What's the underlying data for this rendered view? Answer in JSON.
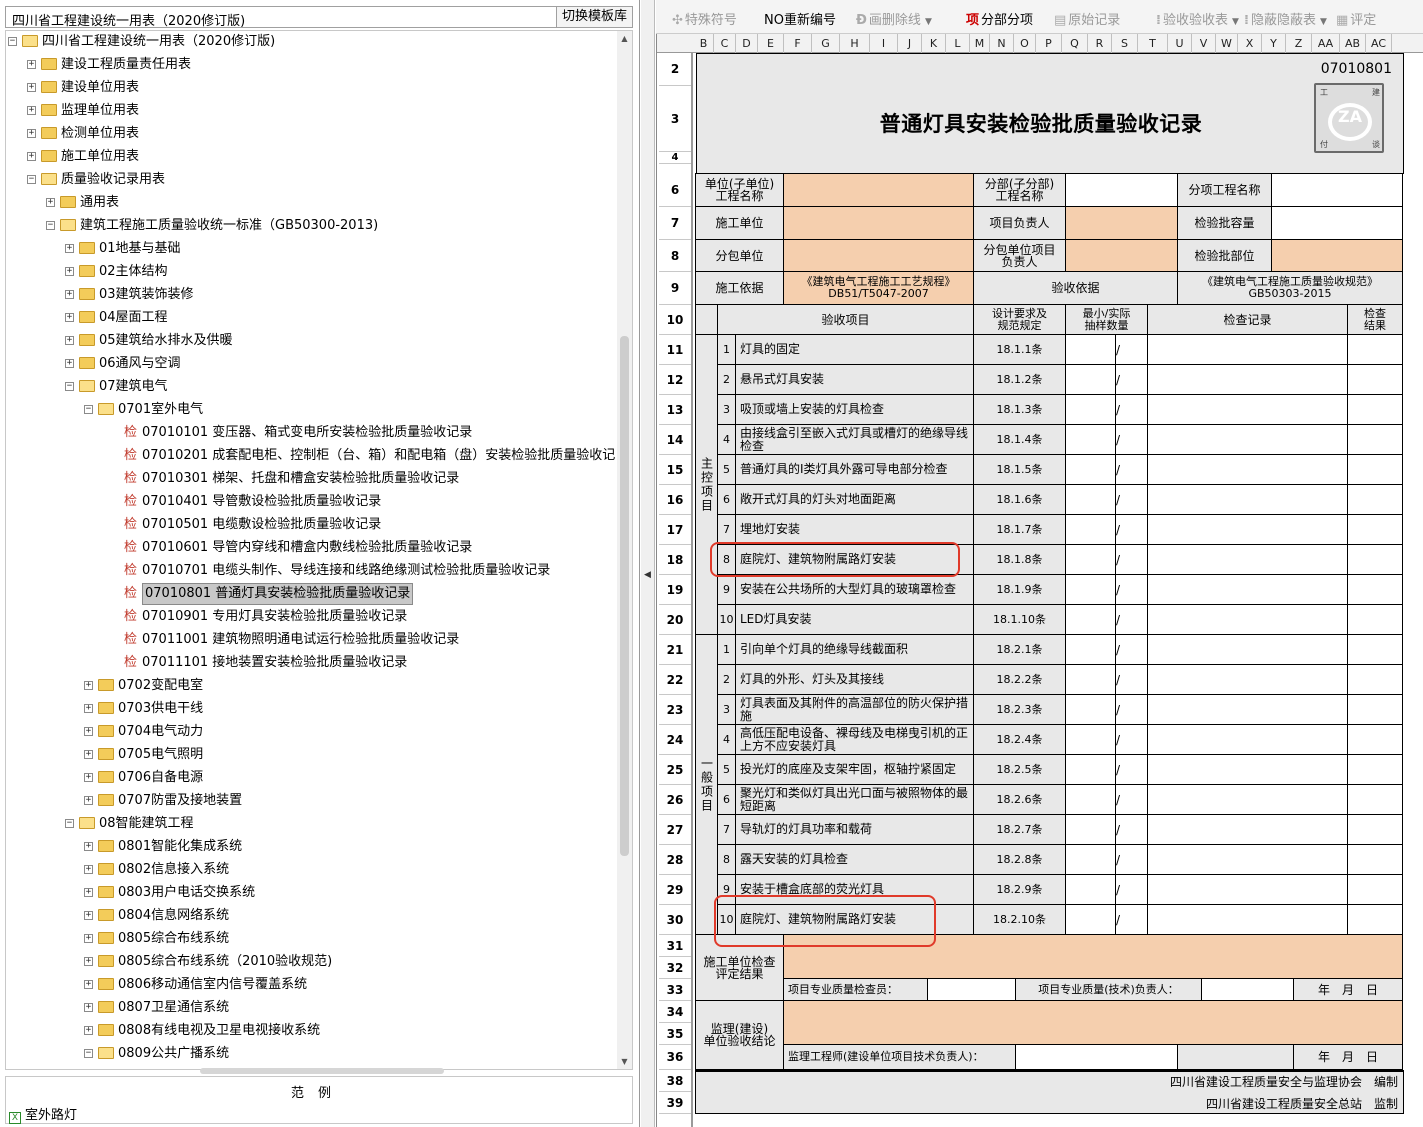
{
  "left": {
    "title": "四川省工程建设统一用表（2020修订版)",
    "switch_button": "切换模板库"
  },
  "tree": [
    {
      "label": "四川省工程建设统一用表（2020修订版)",
      "level": 0,
      "expanded": true,
      "type": "folder"
    },
    {
      "label": "建设工程质量责任用表",
      "level": 1,
      "expanded": false,
      "type": "folder"
    },
    {
      "label": "建设单位用表",
      "level": 1,
      "expanded": false,
      "type": "folder"
    },
    {
      "label": "监理单位用表",
      "level": 1,
      "expanded": false,
      "type": "folder"
    },
    {
      "label": "检测单位用表",
      "level": 1,
      "expanded": false,
      "type": "folder"
    },
    {
      "label": "施工单位用表",
      "level": 1,
      "expanded": false,
      "type": "folder"
    },
    {
      "label": "质量验收记录用表",
      "level": 1,
      "expanded": true,
      "type": "folder"
    },
    {
      "label": "通用表",
      "level": 2,
      "expanded": false,
      "type": "folder"
    },
    {
      "label": "建筑工程施工质量验收统一标准（GB50300-2013)",
      "level": 2,
      "expanded": true,
      "type": "folder"
    },
    {
      "label": "01地基与基础",
      "level": 3,
      "expanded": false,
      "type": "folder"
    },
    {
      "label": "02主体结构",
      "level": 3,
      "expanded": false,
      "type": "folder"
    },
    {
      "label": "03建筑装饰装修",
      "level": 3,
      "expanded": false,
      "type": "folder"
    },
    {
      "label": "04屋面工程",
      "level": 3,
      "expanded": false,
      "type": "folder"
    },
    {
      "label": "05建筑给水排水及供暖",
      "level": 3,
      "expanded": false,
      "type": "folder"
    },
    {
      "label": "06通风与空调",
      "level": 3,
      "expanded": false,
      "type": "folder"
    },
    {
      "label": "07建筑电气",
      "level": 3,
      "expanded": true,
      "type": "folder"
    },
    {
      "label": "0701室外电气",
      "level": 4,
      "expanded": true,
      "type": "folder"
    },
    {
      "label": "07010101 变压器、箱式变电所安装检验批质量验收记录",
      "level": 5,
      "type": "doc"
    },
    {
      "label": "07010201 成套配电柜、控制柜（台、箱）和配电箱（盘）安装检验批质量验收记",
      "level": 5,
      "type": "doc"
    },
    {
      "label": "07010301 梯架、托盘和槽盒安装检验批质量验收记录",
      "level": 5,
      "type": "doc"
    },
    {
      "label": "07010401 导管敷设检验批质量验收记录",
      "level": 5,
      "type": "doc"
    },
    {
      "label": "07010501 电缆敷设检验批质量验收记录",
      "level": 5,
      "type": "doc"
    },
    {
      "label": "07010601 导管内穿线和槽盒内敷线检验批质量验收记录",
      "level": 5,
      "type": "doc"
    },
    {
      "label": "07010701 电缆头制作、导线连接和线路绝缘测试检验批质量验收记录",
      "level": 5,
      "type": "doc"
    },
    {
      "label": "07010801 普通灯具安装检验批质量验收记录",
      "level": 5,
      "type": "doc",
      "selected": true
    },
    {
      "label": "07010901 专用灯具安装检验批质量验收记录",
      "level": 5,
      "type": "doc"
    },
    {
      "label": "07011001 建筑物照明通电试运行检验批质量验收记录",
      "level": 5,
      "type": "doc"
    },
    {
      "label": "07011101 接地装置安装检验批质量验收记录",
      "level": 5,
      "type": "doc"
    },
    {
      "label": "0702变配电室",
      "level": 4,
      "expanded": false,
      "type": "folder"
    },
    {
      "label": "0703供电干线",
      "level": 4,
      "expanded": false,
      "type": "folder"
    },
    {
      "label": "0704电气动力",
      "level": 4,
      "expanded": false,
      "type": "folder"
    },
    {
      "label": "0705电气照明",
      "level": 4,
      "expanded": false,
      "type": "folder"
    },
    {
      "label": "0706自备电源",
      "level": 4,
      "expanded": false,
      "type": "folder"
    },
    {
      "label": "0707防雷及接地装置",
      "level": 4,
      "expanded": false,
      "type": "folder"
    },
    {
      "label": "08智能建筑工程",
      "level": 3,
      "expanded": true,
      "type": "folder"
    },
    {
      "label": "0801智能化集成系统",
      "level": 4,
      "expanded": false,
      "type": "folder"
    },
    {
      "label": "0802信息接入系统",
      "level": 4,
      "expanded": false,
      "type": "folder"
    },
    {
      "label": "0803用户电话交换系统",
      "level": 4,
      "expanded": false,
      "type": "folder"
    },
    {
      "label": "0804信息网络系统",
      "level": 4,
      "expanded": false,
      "type": "folder"
    },
    {
      "label": "0805综合布线系统",
      "level": 4,
      "expanded": false,
      "type": "folder"
    },
    {
      "label": "0805综合布线系统（2010验收规范)",
      "level": 4,
      "expanded": false,
      "type": "folder"
    },
    {
      "label": "0806移动通信室内信号覆盖系统",
      "level": 4,
      "expanded": false,
      "type": "folder"
    },
    {
      "label": "0807卫星通信系统",
      "level": 4,
      "expanded": false,
      "type": "folder"
    },
    {
      "label": "0808有线电视及卫星电视接收系统",
      "level": 4,
      "expanded": false,
      "type": "folder"
    },
    {
      "label": "0809公共广播系统",
      "level": 4,
      "expanded": true,
      "type": "folder"
    }
  ],
  "doc_marker": "检",
  "legend": {
    "title": "范例",
    "item": "室外路灯",
    "item_icon": "excel-icon"
  },
  "toolbar": [
    {
      "label": "特殊符号",
      "icon": "✣",
      "enabled": false
    },
    {
      "label": "NO重新编号",
      "icon": "",
      "enabled": true
    },
    {
      "label": "删除线",
      "icon": "Ð",
      "enabled": false
    },
    {
      "label": "分部分项",
      "icon": "项",
      "enabled": true
    },
    {
      "label": "原始记录",
      "icon": "▤",
      "enabled": false
    },
    {
      "label": "验收",
      "icon": "⁞",
      "enabled": false
    },
    {
      "label": "隐蔽",
      "icon": "⁞",
      "enabled": false
    },
    {
      "label": "评定",
      "icon": "▦",
      "enabled": false
    }
  ],
  "toolbar_extra": {
    "strike_prefix": "画",
    "verify_suffix": "验收表",
    "hidden_suffix": "隐蔽表"
  },
  "columns": [
    "B",
    "C",
    "D",
    "E",
    "F",
    "G",
    "H",
    "I",
    "J",
    "K",
    "L",
    "M",
    "N",
    "O",
    "P",
    "Q",
    "R",
    "S",
    "T",
    "U",
    "V",
    "W",
    "X",
    "Y",
    "Z",
    "AA",
    "AB",
    "AC"
  ],
  "rows": [
    "2",
    "3",
    "4",
    "6",
    "7",
    "8",
    "9",
    "10",
    "11",
    "12",
    "13",
    "14",
    "15",
    "16",
    "17",
    "18",
    "19",
    "20",
    "21",
    "22",
    "23",
    "24",
    "25",
    "26",
    "27",
    "28",
    "29",
    "30",
    "31",
    "32",
    "33",
    "34",
    "35",
    "36",
    "38",
    "39"
  ],
  "form": {
    "code": "07010801",
    "logo_text": "ZA",
    "logo_corners": [
      "工",
      "建",
      "付",
      "谈"
    ],
    "title": "普通灯具安装检验批质量验收记录",
    "h_unit": "单位(子单位)\n工程名称",
    "h_sub": "分部(子分部)\n工程名称",
    "h_item": "分项工程名称",
    "h_contractor": "施工单位",
    "h_pm": "项目负责人",
    "h_capacity": "检验批容量",
    "h_subcontractor": "分包单位",
    "h_sub_pm": "分包单位项目\n负责人",
    "h_part": "检验批部位",
    "h_basis": "施工依据",
    "basis_value": "《建筑电气工程施工工艺规程》\nDB51/T5047-2007",
    "h_accept_basis": "验收依据",
    "accept_basis_value": "《建筑电气工程施工质量验收规范》\nGB50303-2015",
    "col_item": "验收项目",
    "col_req": "设计要求及\n规范规定",
    "col_sample": "最小/实际\n抽样数量",
    "col_record": "检查记录",
    "col_result": "检查\n结果",
    "main_label": "主控项目",
    "general_label": "一般项目",
    "slash": "/",
    "main_items": [
      {
        "n": "1",
        "text": "灯具的固定",
        "req": "18.1.1条"
      },
      {
        "n": "2",
        "text": "悬吊式灯具安装",
        "req": "18.1.2条"
      },
      {
        "n": "3",
        "text": "吸顶或墙上安装的灯具检查",
        "req": "18.1.3条"
      },
      {
        "n": "4",
        "text": "由接线盒引至嵌入式灯具或槽灯的绝缘导线检查",
        "req": "18.1.4条"
      },
      {
        "n": "5",
        "text": "普通灯具的Ⅰ类灯具外露可导电部分检查",
        "req": "18.1.5条"
      },
      {
        "n": "6",
        "text": "敞开式灯具的灯头对地面距离",
        "req": "18.1.6条"
      },
      {
        "n": "7",
        "text": "埋地灯安装",
        "req": "18.1.7条"
      },
      {
        "n": "8",
        "text": "庭院灯、建筑物附属路灯安装",
        "req": "18.1.8条"
      },
      {
        "n": "9",
        "text": "安装在公共场所的大型灯具的玻璃罩检查",
        "req": "18.1.9条"
      },
      {
        "n": "10",
        "text": "LED灯具安装",
        "req": "18.1.10条"
      }
    ],
    "general_items": [
      {
        "n": "1",
        "text": "引向单个灯具的绝缘导线截面积",
        "req": "18.2.1条"
      },
      {
        "n": "2",
        "text": "灯具的外形、灯头及其接线",
        "req": "18.2.2条"
      },
      {
        "n": "3",
        "text": "灯具表面及其附件的高温部位的防火保护措施",
        "req": "18.2.3条"
      },
      {
        "n": "4",
        "text": "高低压配电设备、裸母线及电梯曳引机的正上方不应安装灯具",
        "req": "18.2.4条"
      },
      {
        "n": "5",
        "text": "投光灯的底座及支架牢固，枢轴拧紧固定",
        "req": "18.2.5条"
      },
      {
        "n": "6",
        "text": "聚光灯和类似灯具出光口面与被照物体的最短距离",
        "req": "18.2.6条"
      },
      {
        "n": "7",
        "text": "导轨灯的灯具功率和载荷",
        "req": "18.2.7条"
      },
      {
        "n": "8",
        "text": "露天安装的灯具检查",
        "req": "18.2.8条"
      },
      {
        "n": "9",
        "text": "安装于槽盒底部的荧光灯具",
        "req": "18.2.9条"
      },
      {
        "n": "10",
        "text": "庭院灯、建筑物附属路灯安装",
        "req": "18.2.10条"
      }
    ],
    "contractor_check": "施工单位检查\n评定结果",
    "inspector": "项目专业质量检查员：",
    "tech_lead": "项目专业质量(技术)负责人：",
    "date": "年　月　日",
    "supervisor_conclusion": "监理(建设)\n单位验收结论",
    "supervisor_engineer": "监理工程师(建设单位项目技术负责人)：",
    "footer1": "四川省建设工程质量安全与监理协会　编制",
    "footer2": "四川省建设工程质量安全总站　监制"
  },
  "colors": {
    "highlight": "#e03a2a",
    "input_fill": "#f5cfae",
    "gray_fill": "#e8e8e8",
    "selected": "#c8c8c8"
  }
}
